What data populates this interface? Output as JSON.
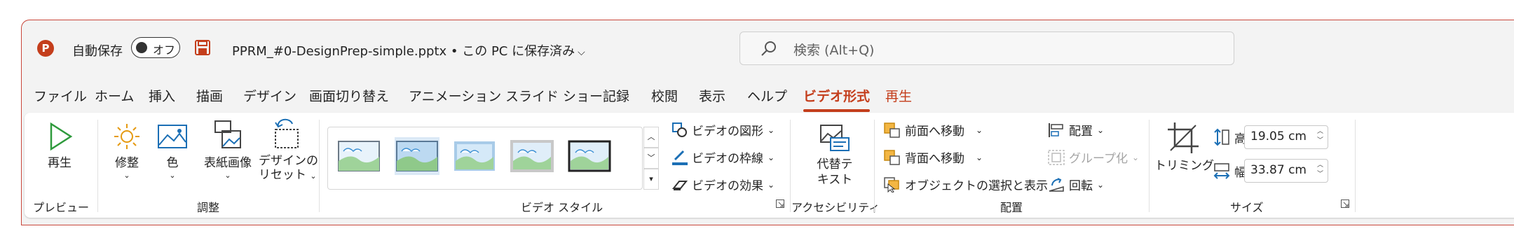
{
  "titlebar": {
    "app_icon_letter": "P",
    "autosave_label": "自動保存",
    "autosave_state": "オフ",
    "file_title": "PPRM_#0-DesignPrep-simple.pptx • この PC に保存済み",
    "search_placeholder": "検索 (Alt+Q)"
  },
  "tabs": [
    {
      "label": "ファイル"
    },
    {
      "label": "ホーム"
    },
    {
      "label": "挿入"
    },
    {
      "label": "描画"
    },
    {
      "label": "デザイン"
    },
    {
      "label": "画面切り替え"
    },
    {
      "label": "アニメーション"
    },
    {
      "label": "スライド ショー"
    },
    {
      "label": "記録"
    },
    {
      "label": "校閲"
    },
    {
      "label": "表示"
    },
    {
      "label": "ヘルプ"
    },
    {
      "label": "ビデオ形式"
    },
    {
      "label": "再生"
    }
  ],
  "active_tab": "ビデオ形式",
  "ribbon": {
    "preview": {
      "play_label": "再生",
      "group": "プレビュー"
    },
    "adjust": {
      "corrections": "修整",
      "color": "色",
      "poster_frame": "表紙画像",
      "reset_line1": "デザインの",
      "reset_line2": "リセット",
      "group": "調整"
    },
    "video_styles": {
      "shape": "ビデオの図形",
      "border": "ビデオの枠線",
      "effects": "ビデオの効果",
      "group": "ビデオ スタイル"
    },
    "accessibility": {
      "alt_line1": "代替テ",
      "alt_line2": "キスト",
      "group": "アクセシビリティ"
    },
    "arrange": {
      "bring_forward": "前面へ移動",
      "send_backward": "背面へ移動",
      "selection_pane": "オブジェクトの選択と表示",
      "align": "配置",
      "group_cmd": "グループ化",
      "rotate": "回転",
      "group": "配置"
    },
    "size": {
      "crop": "トリミング",
      "height_label": "高さ:",
      "height_value": "19.05 cm",
      "width_label": "幅:",
      "width_value": "33.87 cm",
      "group": "サイズ"
    }
  },
  "colors": {
    "accent": "#c43e1c",
    "ribbon_bg": "#ffffff",
    "frame_bg": "#f3f3f3"
  }
}
